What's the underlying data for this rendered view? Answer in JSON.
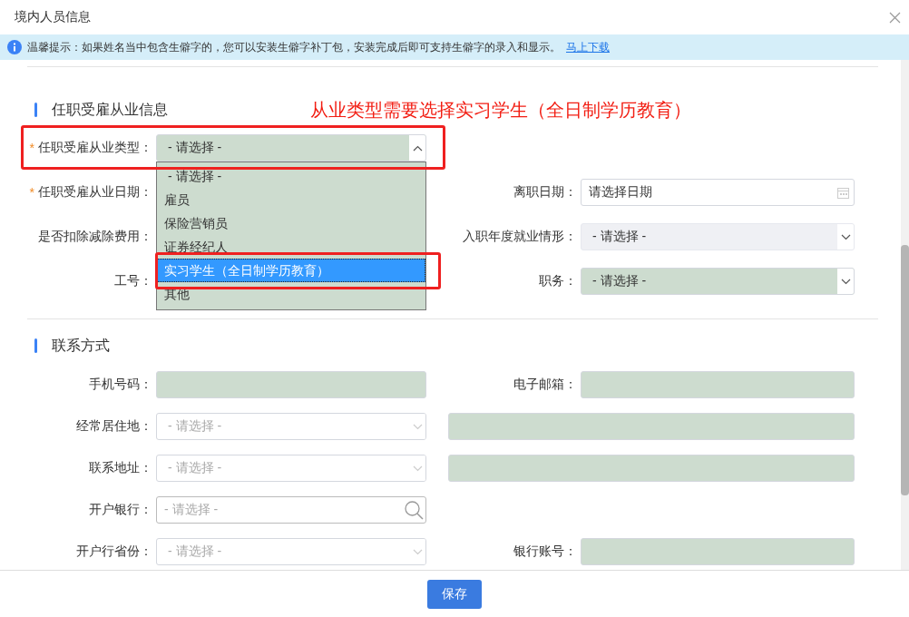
{
  "window": {
    "title": "境内人员信息"
  },
  "notice": {
    "text": "温馨提示：如果姓名当中包含生僻字的，您可以安装生僻字补丁包，安装完成后即可支持生僻字的录入和显示。",
    "link": "马上下载"
  },
  "annotation": "从业类型需要选择实习学生（全日制学历教育）",
  "sections": [
    {
      "title": "任职受雇从业信息",
      "rows": [
        [
          {
            "required_mark": "*",
            "label": "任职受雇从业类型：",
            "kind": "select",
            "value": "- 请选择 -",
            "filled": true,
            "disabled": false,
            "open": true
          }
        ],
        [
          {
            "required_mark": "*",
            "label": "任职受雇从业日期：",
            "kind": "covered"
          },
          {
            "label": "离职日期：",
            "kind": "date",
            "value": "请选择日期",
            "filled": false,
            "disabled": false
          }
        ],
        [
          {
            "label": "是否扣除减除费用：",
            "kind": "covered"
          },
          {
            "label": "入职年度就业情形：",
            "kind": "select",
            "value": "- 请选择 -",
            "filled": false,
            "disabled": true,
            "open": false
          }
        ],
        [
          {
            "label": "工号：",
            "kind": "covered"
          },
          {
            "label": "职务：",
            "kind": "select",
            "value": "- 请选择 -",
            "filled": true,
            "disabled": false,
            "open": false
          }
        ]
      ]
    },
    {
      "title": "联系方式",
      "rows": [
        [
          {
            "label": "手机号码：",
            "kind": "text",
            "filled": true,
            "disabled": false
          },
          {
            "label": "电子邮箱：",
            "kind": "text",
            "filled": true,
            "disabled": false
          }
        ],
        [
          {
            "label": "经常居住地：",
            "kind": "select",
            "placeholder": "- 请选择 -",
            "filled": false,
            "disabled": false,
            "open": false
          },
          {
            "kind": "text",
            "filled": true,
            "disabled": false
          }
        ],
        [
          {
            "label": "联系地址：",
            "kind": "select",
            "placeholder": "- 请选择 -",
            "filled": false,
            "disabled": false,
            "open": false
          },
          {
            "kind": "text",
            "filled": true,
            "disabled": false
          }
        ],
        [
          {
            "label": "开户银行：",
            "kind": "search",
            "placeholder": "- 请选择 -",
            "filled": false,
            "disabled": false
          }
        ],
        [
          {
            "label": "开户行省份：",
            "kind": "select",
            "placeholder": "- 请选择 -",
            "filled": false,
            "disabled": false,
            "open": false
          },
          {
            "label": "银行账号：",
            "kind": "text",
            "filled": true,
            "disabled": false
          }
        ]
      ]
    }
  ],
  "employment_type_dropdown": {
    "options": [
      {
        "label": "- 请选择 -",
        "selected": false
      },
      {
        "label": "雇员",
        "selected": false
      },
      {
        "label": "保险营销员",
        "selected": false
      },
      {
        "label": "证券经纪人",
        "selected": false
      },
      {
        "label": "实习学生（全日制学历教育）",
        "selected": true
      },
      {
        "label": "其他",
        "selected": false
      }
    ]
  },
  "save_button": "保存"
}
